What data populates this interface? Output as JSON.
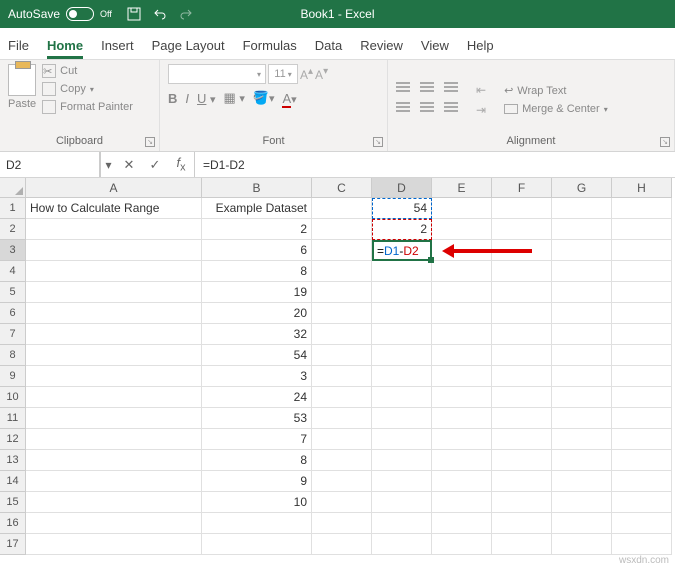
{
  "titlebar": {
    "autosave_label": "AutoSave",
    "autosave_state": "Off",
    "doc_title": "Book1 - Excel"
  },
  "tabs": {
    "file": "File",
    "home": "Home",
    "insert": "Insert",
    "pagelayout": "Page Layout",
    "formulas": "Formulas",
    "data": "Data",
    "review": "Review",
    "view": "View",
    "help": "Help"
  },
  "ribbon": {
    "clipboard": {
      "label": "Clipboard",
      "paste": "Paste",
      "cut": "Cut",
      "copy": "Copy",
      "format_painter": "Format Painter"
    },
    "font": {
      "label": "Font",
      "name": "",
      "size": "11"
    },
    "alignment": {
      "label": "Alignment",
      "wrap": "Wrap Text",
      "merge": "Merge & Center"
    }
  },
  "formulabar": {
    "namebox": "D2",
    "formula": "=D1-D2"
  },
  "columns": [
    "A",
    "B",
    "C",
    "D",
    "E",
    "F",
    "G",
    "H"
  ],
  "rows": [
    "1",
    "2",
    "3",
    "4",
    "5",
    "6",
    "7",
    "8",
    "9",
    "10",
    "11",
    "12",
    "13",
    "14",
    "15",
    "16",
    "17"
  ],
  "cells": {
    "A1": "How to Calculate Range",
    "B1": "Example Dataset",
    "B2": "2",
    "B3": "6",
    "B4": "8",
    "B5": "19",
    "B6": "20",
    "B7": "32",
    "B8": "54",
    "B9": "3",
    "B10": "24",
    "B11": "53",
    "B12": "7",
    "B13": "8",
    "B14": "9",
    "B15": "10",
    "D1": "54",
    "D2": "2"
  },
  "edit_cell": {
    "ref": "D3",
    "parts": [
      {
        "t": "=",
        "c": "fblack"
      },
      {
        "t": "D1",
        "c": "fblue"
      },
      {
        "t": "-",
        "c": "fblack"
      },
      {
        "t": "D2",
        "c": "fred"
      }
    ]
  },
  "watermark": "wsxdn.com"
}
